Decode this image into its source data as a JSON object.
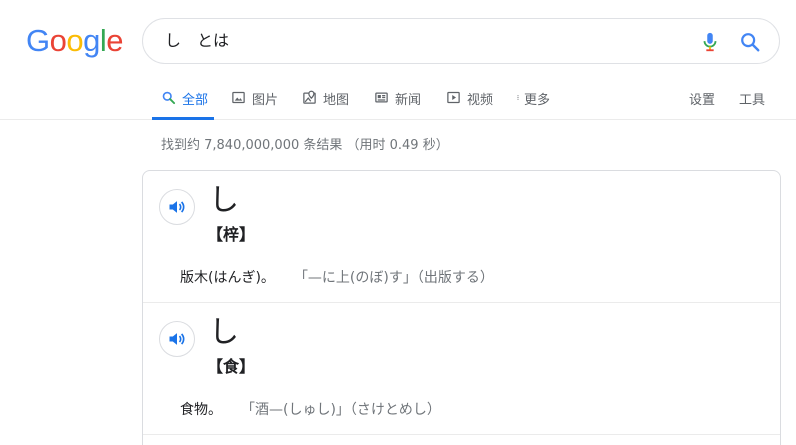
{
  "logo": {
    "letters": [
      "G",
      "o",
      "o",
      "g",
      "l",
      "e"
    ],
    "colors": [
      "#4285F4",
      "#EA4335",
      "#FBBC05",
      "#4285F4",
      "#34A853",
      "#EA4335"
    ]
  },
  "search": {
    "query": "し　とは"
  },
  "tabs": {
    "all": "全部",
    "images": "图片",
    "maps": "地图",
    "news": "新闻",
    "videos": "视频",
    "more": "更多",
    "settings": "设置",
    "tools": "工具"
  },
  "stats": "找到约 7,840,000,000 条结果 （用时 0.49 秒）",
  "entries": [
    {
      "headword": "し",
      "kanji": "【梓】",
      "definition": "版木(はんぎ)。",
      "example": "「—に上(のぼ)す」（出版する）"
    },
    {
      "headword": "し",
      "kanji": "【食】",
      "definition": "食物。",
      "example": "「酒—(しゅし)」（さけとめし）"
    }
  ],
  "colors": {
    "accent": "#1a73e8",
    "muted": "#70757a",
    "border": "#dadce0"
  }
}
